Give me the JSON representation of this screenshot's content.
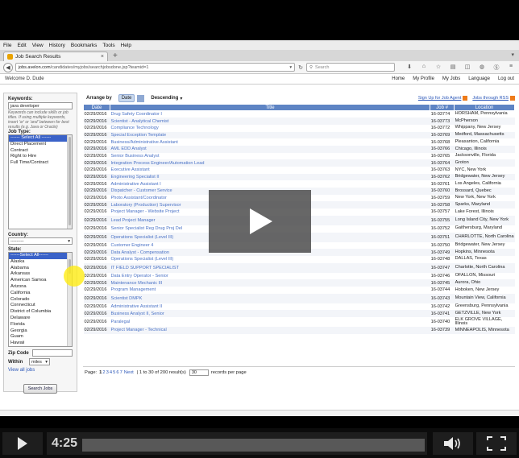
{
  "menubar": [
    "File",
    "Edit",
    "View",
    "History",
    "Bookmarks",
    "Tools",
    "Help"
  ],
  "tab": {
    "title": "Job Search Results",
    "close": "×",
    "new": "+"
  },
  "url": {
    "host": "jobs.avelon.com",
    "path": "/candidates/myjobs/searchjobsdone.jsp?teamid=1"
  },
  "search_placeholder": "Search",
  "site": {
    "welcome": "Welcome D. Dude",
    "nav": [
      "Home",
      "My Profile",
      "My Jobs",
      "Language",
      "Log out"
    ]
  },
  "sidebar": {
    "keywords_label": "Keywords:",
    "keywords_value": "java developer",
    "keywords_hint": "Keywords can include skills or job titles. If using multiple keywords, insert 'or' or 'and' between for best results (e.g. Java or Oracle)",
    "jobtype_label": "Job Type:",
    "jobtypes": [
      "------ Select All ------",
      "Direct Placement",
      "Contract",
      "Right to Hire",
      "Full Time/Contract"
    ],
    "country_label": "Country:",
    "country_value": "---------",
    "state_label": "State:",
    "states": [
      "------Select All------",
      "Alaska",
      "Alabama",
      "Arkansas",
      "American Samoa",
      "Arizona",
      "California",
      "Colorado",
      "Connecticut",
      "District of Columbia",
      "Delaware",
      "Florida",
      "Georgia",
      "Guam",
      "Hawaii"
    ],
    "zip_label": "Zip Code",
    "within_label": "Within",
    "within_value": "miles",
    "view_all": "View all jobs",
    "search_button": "Search Jobs"
  },
  "arrange": {
    "label": "Arrange by",
    "field": "Date",
    "order": "Descending",
    "agent_link": "Sign Up for Job Agent",
    "rss_link": "Jobs through RSS"
  },
  "table": {
    "headers": [
      "Date",
      "Title",
      "Job #",
      "Location"
    ],
    "rows": [
      [
        "02/29/2016",
        "Drug Safety Coordinator I",
        "16-03774",
        "HORSHAM, Pennsylvania"
      ],
      [
        "02/29/2016",
        "Scientist - Analytical Chemist",
        "16-03773",
        "McPherson"
      ],
      [
        "02/29/2016",
        "Compliance Technology",
        "16-03772",
        "Whippany, New Jersey"
      ],
      [
        "02/29/2016",
        "Special Exception Template",
        "16-03769",
        "Medford, Massachusetts"
      ],
      [
        "02/29/2016",
        "Business/Administrative Assistant",
        "16-03768",
        "Pleasanton, California"
      ],
      [
        "02/29/2016",
        "AML EDD Analyst",
        "16-03766",
        "Chicago, Illinois"
      ],
      [
        "02/29/2016",
        "Senior Business Analyst",
        "16-03765",
        "Jacksonville, Florida"
      ],
      [
        "02/29/2016",
        "Integration Process Engineer/Automation Lead",
        "16-03764",
        "Groton"
      ],
      [
        "02/29/2016",
        "Executive Assistant",
        "16-03763",
        "NYC, New York"
      ],
      [
        "02/29/2016",
        "Engineering Specialist II",
        "16-03762",
        "Bridgewater, New Jersey"
      ],
      [
        "02/29/2016",
        "Administrative Assistant I",
        "16-03761",
        "Los Angeles, California"
      ],
      [
        "02/29/2016",
        "Dispatcher - Customer Service",
        "16-03760",
        "Brossard, Quebec"
      ],
      [
        "02/29/2016",
        "Photo Assistant/Coordinator",
        "16-03759",
        "New York, New York"
      ],
      [
        "02/29/2016",
        "Laboratory (Production) Supervisor",
        "16-03758",
        "Sparks, Maryland"
      ],
      [
        "02/29/2016",
        "Project Manager - Website Project",
        "16-03757",
        "Lake Forest, Illinois"
      ],
      [
        "02/29/2016",
        "Lead Project Manager",
        "16-03755",
        "Long Island City, New York"
      ],
      [
        "02/29/2016",
        "Senior Specialist Reg Drug Proj Del",
        "16-03752",
        "Gaithersburg, Maryland"
      ],
      [
        "02/29/2016",
        "Operations Specialist (Level III)",
        "16-03751",
        "CHARLOTTE, North Carolina"
      ],
      [
        "02/29/2016",
        "Customer Engineer 4",
        "16-03750",
        "Bridgewater, New Jersey"
      ],
      [
        "02/29/2016",
        "Data Analyst - Compensation",
        "16-03749",
        "Hopkins, Minnesota"
      ],
      [
        "02/29/2016",
        "Operations Specialist (Level III)",
        "16-03748",
        "DALLAS, Texas"
      ],
      [
        "02/29/2016",
        "IT FIELD SUPPORT SPECIALIST",
        "16-03747",
        "Charlotte, North Carolina"
      ],
      [
        "02/29/2016",
        "Data Entry Operator - Senior",
        "16-03746",
        "OFALLON, Missouri"
      ],
      [
        "02/29/2016",
        "Maintenance Mechanic III",
        "16-03745",
        "Aurora, Ohio"
      ],
      [
        "02/29/2016",
        "Program Management",
        "16-03744",
        "Hoboken, New Jersey"
      ],
      [
        "02/29/2016",
        "Scientist DMPK",
        "16-03743",
        "Mountain View, California"
      ],
      [
        "02/29/2016",
        "Administrative Assistant II",
        "16-03742",
        "Greensburg, Pennsylvania"
      ],
      [
        "02/29/2016",
        "Business Analyst II, Senior",
        "16-03741",
        "GETZVILLE, New York"
      ],
      [
        "02/29/2016",
        "Paralegal",
        "16-03740",
        "ELK GROVE VILLAGE, Illinois"
      ],
      [
        "02/29/2016",
        "Project Manager - Technical",
        "16-03739",
        "MINNEAPOLIS, Minnesota"
      ]
    ]
  },
  "pager": {
    "label": "Page:",
    "current": "1",
    "pages": [
      "2",
      "3",
      "4",
      "5",
      "6",
      "7"
    ],
    "next": "Next",
    "summary": "| 1 to 30 of 200 result(s)",
    "per_page": "30",
    "per_page_suffix": "records per page"
  },
  "video": {
    "time": "4:25"
  }
}
